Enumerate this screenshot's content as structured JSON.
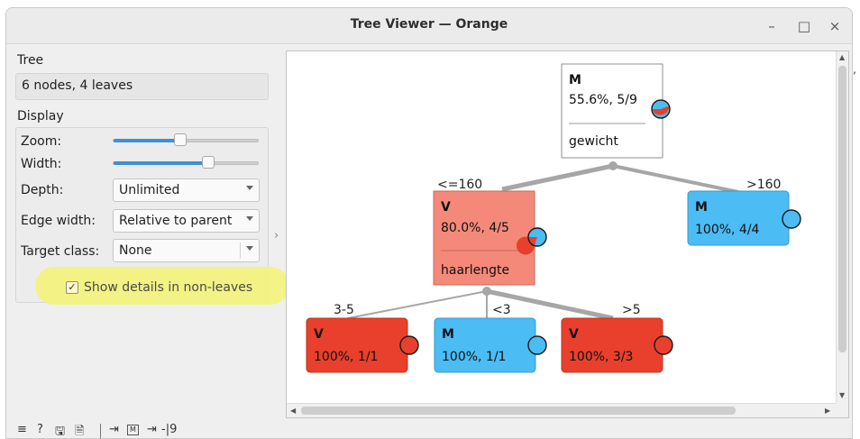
{
  "window": {
    "title": "Tree Viewer — Orange",
    "minimize": "–",
    "maximize": "□",
    "close": "×"
  },
  "tree_info": {
    "heading": "Tree",
    "summary": "6 nodes, 4 leaves"
  },
  "display": {
    "heading": "Display",
    "zoom_label": "Zoom:",
    "zoom_level": 0.45,
    "width_label": "Width:",
    "width_level": 0.66,
    "depth_label": "Depth:",
    "depth_value": "Unlimited",
    "edge_width_label": "Edge width:",
    "edge_width_value": "Relative to parent",
    "target_class_label": "Target class:",
    "target_class_value": "None",
    "show_details_label": "Show details in non-leaves",
    "show_details_checked": true,
    "check_mark": "✓"
  },
  "splitter": {
    "arrow": "›"
  },
  "colors": {
    "class_M": "#4bbcf4",
    "class_V": "#e8402c",
    "selected_V": "#f4897a",
    "edge": "#a6a6a6",
    "highlight": "#f4f37a",
    "accent": "#3d8fd6"
  },
  "tree": {
    "nodes": [
      {
        "id": "root",
        "cls": "M",
        "stats": "55.6%, 5/9",
        "split": "gewicht",
        "pie_v": 0.444
      },
      {
        "id": "n_le160",
        "cls": "V",
        "stats": "80.0%, 4/5",
        "split": "haarlengte",
        "pie_v": 0.8,
        "edge_label": "<=160"
      },
      {
        "id": "n_gt160",
        "cls": "M",
        "stats": "100%, 4/4",
        "pie_v": 0,
        "edge_label": ">160"
      },
      {
        "id": "n_3_5",
        "cls": "V",
        "stats": "100%, 1/1",
        "pie_v": 1,
        "edge_label": "3-5"
      },
      {
        "id": "n_lt3",
        "cls": "M",
        "stats": "100%, 1/1",
        "pie_v": 0,
        "edge_label": "<3"
      },
      {
        "id": "n_gt5",
        "cls": "V",
        "stats": "100%, 3/3",
        "pie_v": 1,
        "edge_label": ">5"
      }
    ]
  },
  "status_bar": {
    "menu_icon": "menu-icon",
    "help_icon": "help-icon",
    "save_icon": "save-icon",
    "report_icon": "report-icon",
    "input_icon": "input-icon",
    "input_signal": "M",
    "output_icon": "output-icon",
    "output_text": "-|9",
    "menu_glyph": "≡",
    "help_glyph": "?",
    "save_glyph": "🖫",
    "report_glyph": "🗎",
    "input_glyph": "⇥",
    "output_glyph": "⇥"
  },
  "edge_caption": "‚"
}
